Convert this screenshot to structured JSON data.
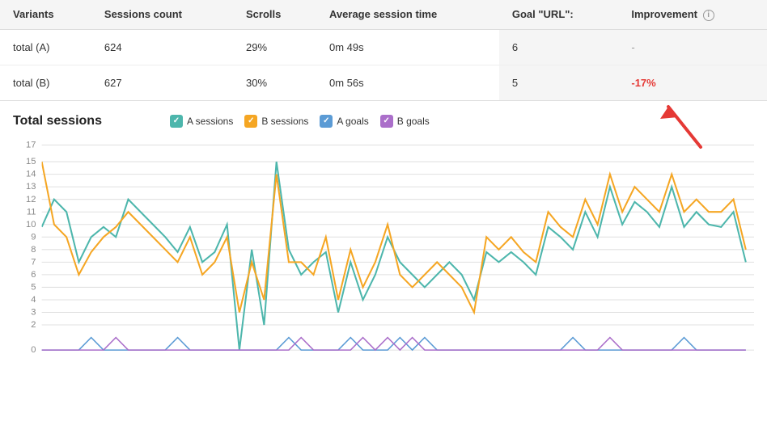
{
  "table": {
    "headers": [
      "Variants",
      "Sessions count",
      "Scrolls",
      "Average session time",
      "Goal \"URL\":",
      "Improvement"
    ],
    "rows": [
      {
        "variant": "total (A)",
        "sessions_count": "624",
        "scrolls": "29%",
        "avg_session_time": "0m 49s",
        "goal": "6",
        "improvement": "-",
        "improvement_type": "dash"
      },
      {
        "variant": "total (B)",
        "sessions_count": "627",
        "scrolls": "30%",
        "avg_session_time": "0m 56s",
        "goal": "5",
        "improvement": "-17%",
        "improvement_type": "negative"
      }
    ]
  },
  "chart": {
    "title": "Total sessions",
    "legend": [
      {
        "label": "A sessions",
        "color": "#4db6ac",
        "type": "check"
      },
      {
        "label": "B sessions",
        "color": "#f5a623",
        "type": "check"
      },
      {
        "label": "A goals",
        "color": "#5b9bd5",
        "type": "check"
      },
      {
        "label": "B goals",
        "color": "#ab6fca",
        "type": "check"
      }
    ],
    "y_axis": [
      0,
      2,
      3,
      4,
      5,
      6,
      7,
      8,
      9,
      10,
      11,
      12,
      13,
      14,
      15,
      17
    ],
    "info_icon_label": "i"
  }
}
